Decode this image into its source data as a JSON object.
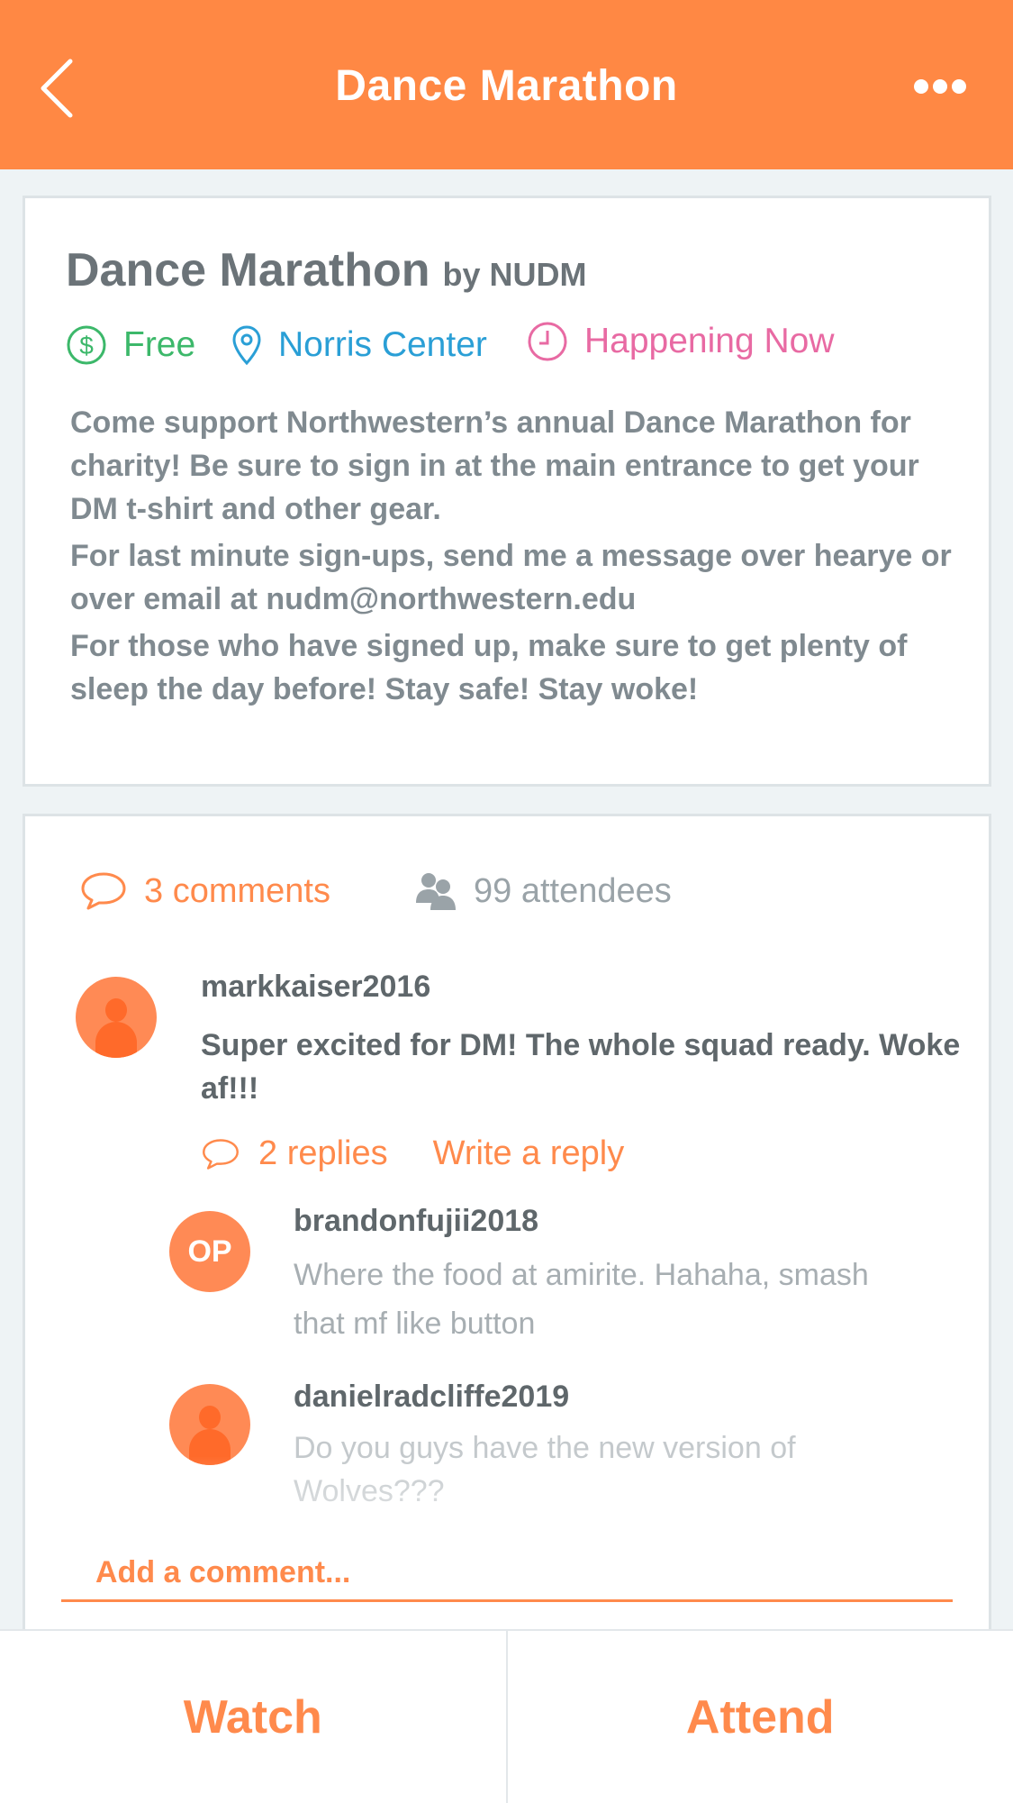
{
  "nav": {
    "title": "Dance Marathon"
  },
  "event": {
    "title": "Dance Marathon",
    "host": "by NUDM",
    "price": "Free",
    "location": "Norris Center",
    "time_status": "Happening Now",
    "description": [
      "Come support Northwestern’s annual Dance Marathon for charity! Be sure to sign in at the main entrance to get your DM t-shirt and other gear.",
      "For last minute sign-ups, send me a message over hearye or over email at nudm@northwestern.edu",
      "For those who have signed up, make sure to get plenty of sleep the day before! Stay safe! Stay woke!"
    ]
  },
  "stats": {
    "comments": "3 comments",
    "attendees": "99 attendees"
  },
  "comments": [
    {
      "username": "markkaiser2016",
      "text": "Super excited for DM! The whole squad ready. Woke af!!!",
      "replies_label": "2 replies",
      "write_reply_label": "Write a reply",
      "replies": [
        {
          "avatar_label": "OP",
          "username": "brandonfujii2018",
          "text": "Where the food at amirite. Hahaha, smash that mf like button"
        },
        {
          "username": "danielradcliffe2019",
          "text": "Do you guys have the new version of Wolves???"
        }
      ]
    }
  ],
  "add_comment": {
    "placeholder": "Add a comment..."
  },
  "actions": {
    "watch": "Watch",
    "attend": "Attend"
  },
  "colors": {
    "brand": "#ff8844",
    "price": "#3cb86a",
    "location": "#2a9fd6",
    "time": "#e86aa3",
    "muted": "#9aa3a8"
  },
  "icons": {
    "back": "chevron-left-icon",
    "more": "more-horizontal-icon",
    "price": "dollar-circle-icon",
    "location": "map-pin-icon",
    "time": "clock-icon",
    "comments": "speech-bubble-icon",
    "attendees": "people-icon"
  }
}
